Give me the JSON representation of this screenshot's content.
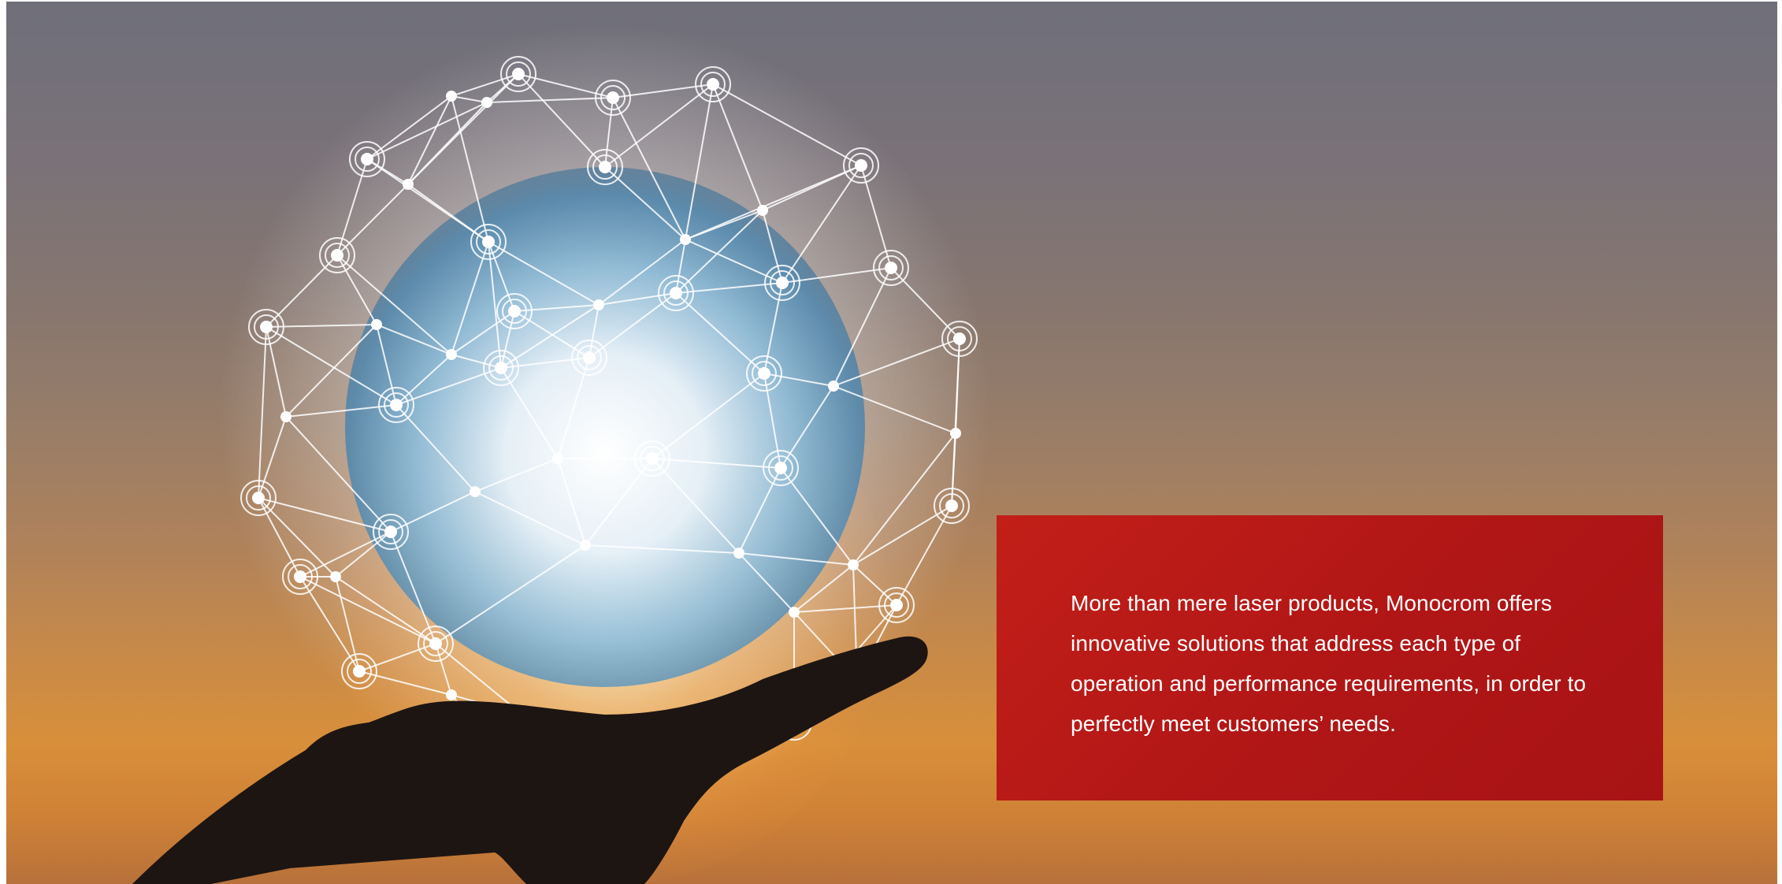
{
  "hero": {
    "description_text": "More than mere laser products, Monocrom offers innovative solutions that address each type of operation and performance requirements, in order to perfectly meet customers’ needs.",
    "box_color": "#b51a16",
    "sky_top_color": "#6f6f7a",
    "sky_bottom_color": "#d88f3a"
  },
  "image": {
    "subject": "hand holding glowing globe with network mesh",
    "icon": "network-globe-icon"
  }
}
